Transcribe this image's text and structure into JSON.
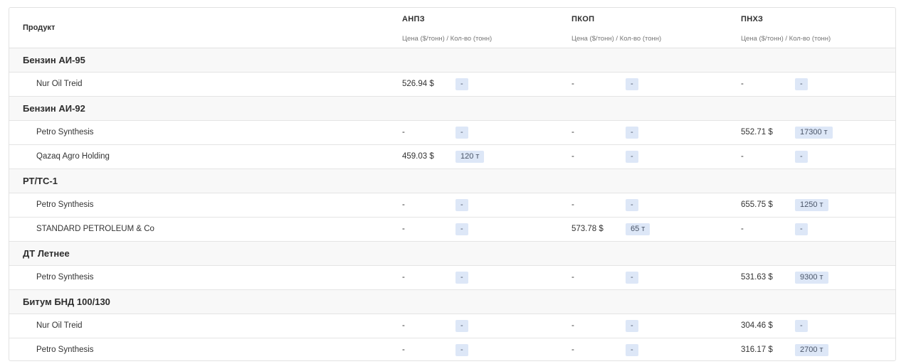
{
  "header": {
    "product_label": "Продукт",
    "columns": [
      {
        "name": "АНПЗ",
        "sub": "Цена ($/тонн) / Кол-во (тонн)"
      },
      {
        "name": "ПКОП",
        "sub": "Цена ($/тонн) / Кол-во (тонн)"
      },
      {
        "name": "ПНХЗ",
        "sub": "Цена ($/тонн) / Кол-во (тонн)"
      }
    ]
  },
  "groups": [
    {
      "name": "Бензин АИ-95",
      "rows": [
        {
          "supplier": "Nur Oil Treid",
          "cells": [
            {
              "price": "526.94 $",
              "qty": "-"
            },
            {
              "price": "-",
              "qty": "-"
            },
            {
              "price": "-",
              "qty": "-"
            }
          ]
        }
      ]
    },
    {
      "name": "Бензин АИ-92",
      "rows": [
        {
          "supplier": "Petro Synthesis",
          "cells": [
            {
              "price": "-",
              "qty": "-"
            },
            {
              "price": "-",
              "qty": "-"
            },
            {
              "price": "552.71 $",
              "qty": "17300 т"
            }
          ]
        },
        {
          "supplier": "Qazaq Agro Holding",
          "cells": [
            {
              "price": "459.03 $",
              "qty": "120 т"
            },
            {
              "price": "-",
              "qty": "-"
            },
            {
              "price": "-",
              "qty": "-"
            }
          ]
        }
      ]
    },
    {
      "name": "РТ/ТС-1",
      "rows": [
        {
          "supplier": "Petro Synthesis",
          "cells": [
            {
              "price": "-",
              "qty": "-"
            },
            {
              "price": "-",
              "qty": "-"
            },
            {
              "price": "655.75 $",
              "qty": "1250 т"
            }
          ]
        },
        {
          "supplier": "STANDARD PETROLEUM & Co",
          "cells": [
            {
              "price": "-",
              "qty": "-"
            },
            {
              "price": "573.78 $",
              "qty": "65 т"
            },
            {
              "price": "-",
              "qty": "-"
            }
          ]
        }
      ]
    },
    {
      "name": "ДТ Летнее",
      "rows": [
        {
          "supplier": "Petro Synthesis",
          "cells": [
            {
              "price": "-",
              "qty": "-"
            },
            {
              "price": "-",
              "qty": "-"
            },
            {
              "price": "531.63 $",
              "qty": "9300 т"
            }
          ]
        }
      ]
    },
    {
      "name": "Битум БНД 100/130",
      "rows": [
        {
          "supplier": "Nur Oil Treid",
          "cells": [
            {
              "price": "-",
              "qty": "-"
            },
            {
              "price": "-",
              "qty": "-"
            },
            {
              "price": "304.46 $",
              "qty": "-"
            }
          ]
        },
        {
          "supplier": "Petro Synthesis",
          "cells": [
            {
              "price": "-",
              "qty": "-"
            },
            {
              "price": "-",
              "qty": "-"
            },
            {
              "price": "316.17 $",
              "qty": "2700 т"
            }
          ]
        }
      ]
    }
  ]
}
